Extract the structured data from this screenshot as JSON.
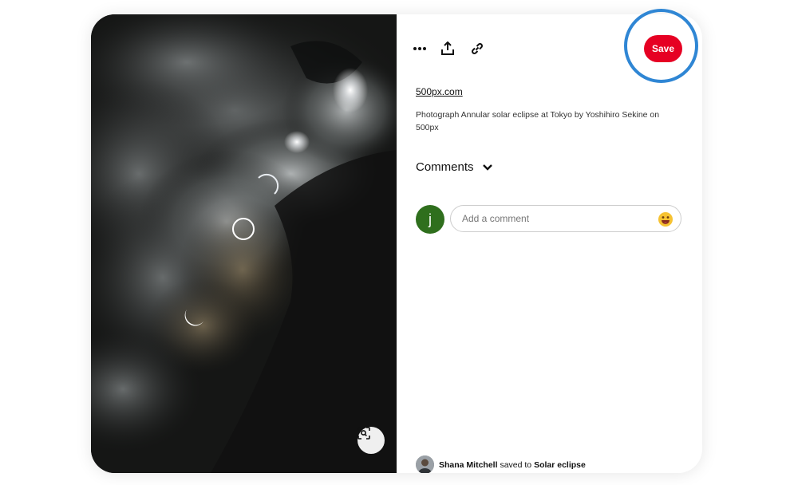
{
  "pin": {
    "source_link": "500px.com",
    "description": "Photograph Annular solar eclipse at Tokyo by Yoshihiro Sekine on 500px",
    "save_label": "Save"
  },
  "toolbar": {
    "more_icon": "more-horizontal-icon",
    "share_icon": "share-upload-icon",
    "link_icon": "link-icon"
  },
  "comments": {
    "header": "Comments",
    "avatar_letter": "j",
    "placeholder": "Add a comment"
  },
  "saved_by": {
    "user": "Shana Mitchell",
    "middle": "saved to",
    "board": "Solar eclipse"
  },
  "colors": {
    "save_button": "#e60023",
    "highlight_ring": "#2f86d4",
    "avatar_bg": "#2f6f1d"
  }
}
